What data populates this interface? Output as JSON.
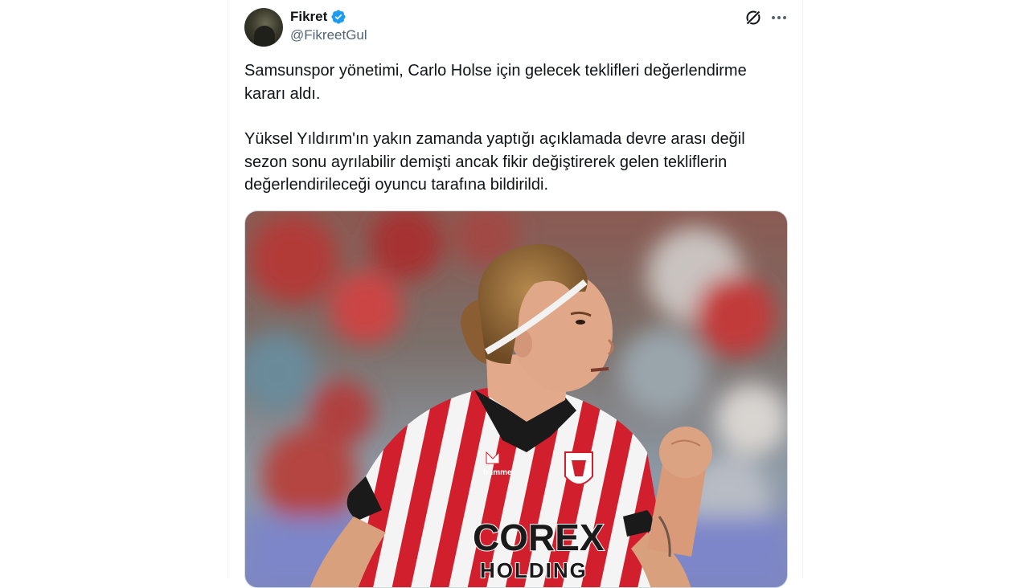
{
  "tweet": {
    "author": {
      "display_name": "Fikret",
      "handle": "@FikreetGul",
      "verified": true
    },
    "paragraphs": [
      "Samsunspor yönetimi, Carlo Holse için gelecek teklifleri değerlendirme kararı aldı.",
      "Yüksel Yıldırım'ın yakın zamanda yaptığı açıklamada devre arası değil sezon sonu ayrılabilir demişti ancak fikir değiştirerek gelen tekliflerin değerlendirileceği oyuncu tarafına bildirildi."
    ],
    "media": {
      "jersey_sponsor_line1": "COREX",
      "jersey_sponsor_line2": "HOLDING",
      "jersey_brand": "hummel"
    }
  },
  "icons": {
    "verified": "verified-badge-icon",
    "grok": "grok-icon",
    "more": "more-dots-icon"
  },
  "colors": {
    "verified_blue": "#1d9bf0",
    "secondary_text": "#536471",
    "jersey_red": "#d21f2d",
    "jersey_black": "#1a1a1a"
  }
}
